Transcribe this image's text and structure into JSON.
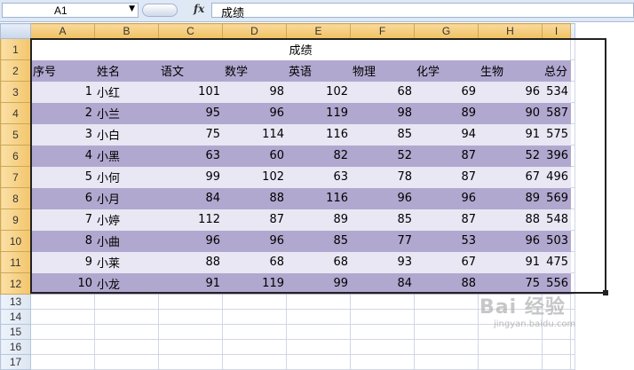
{
  "formula_bar": {
    "cell_ref": "A1",
    "fx_label": "fx",
    "content": "成绩"
  },
  "grid": {
    "columns": [
      "A",
      "B",
      "C",
      "D",
      "E",
      "F",
      "G",
      "H",
      "I"
    ],
    "rows": [
      "1",
      "2",
      "3",
      "4",
      "5",
      "6",
      "7",
      "8",
      "9",
      "10",
      "11",
      "12",
      "13",
      "14",
      "15",
      "16",
      "17"
    ]
  },
  "sheet": {
    "title": "成绩",
    "headers": [
      "序号",
      "姓名",
      "语文",
      "数学",
      "英语",
      "物理",
      "化学",
      "生物",
      "总分"
    ],
    "records": [
      [
        "1",
        "小红",
        "101",
        "98",
        "102",
        "68",
        "69",
        "96",
        "534"
      ],
      [
        "2",
        "小兰",
        "95",
        "96",
        "119",
        "98",
        "89",
        "90",
        "587"
      ],
      [
        "3",
        "小白",
        "75",
        "114",
        "116",
        "85",
        "94",
        "91",
        "575"
      ],
      [
        "4",
        "小黑",
        "63",
        "60",
        "82",
        "52",
        "87",
        "52",
        "396"
      ],
      [
        "5",
        "小何",
        "99",
        "102",
        "63",
        "78",
        "87",
        "67",
        "496"
      ],
      [
        "6",
        "小月",
        "84",
        "88",
        "116",
        "96",
        "96",
        "89",
        "569"
      ],
      [
        "7",
        "小婷",
        "112",
        "87",
        "89",
        "85",
        "87",
        "88",
        "548"
      ],
      [
        "8",
        "小曲",
        "96",
        "96",
        "85",
        "77",
        "53",
        "96",
        "503"
      ],
      [
        "9",
        "小莱",
        "88",
        "68",
        "68",
        "93",
        "67",
        "91",
        "475"
      ],
      [
        "10",
        "小龙",
        "91",
        "119",
        "99",
        "84",
        "88",
        "75",
        "556"
      ]
    ]
  },
  "colors": {
    "band_dark": "#b1a8cf",
    "band_light": "#e8e7f3",
    "header_highlight": "#f1c15f"
  },
  "watermark": {
    "brand": "Bai 经验",
    "url": "jingyan.baidu.com"
  }
}
